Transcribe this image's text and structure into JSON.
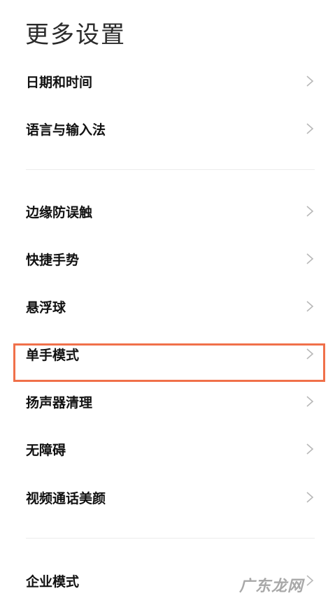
{
  "header": {
    "title": "更多设置"
  },
  "groups": [
    {
      "items": [
        {
          "label": "日期和时间"
        },
        {
          "label": "语言与输入法"
        }
      ]
    },
    {
      "items": [
        {
          "label": "边缘防误触"
        },
        {
          "label": "快捷手势"
        },
        {
          "label": "悬浮球"
        },
        {
          "label": "单手模式",
          "highlighted": true
        },
        {
          "label": "扬声器清理"
        },
        {
          "label": "无障碍"
        },
        {
          "label": "视频通话美颜"
        }
      ]
    },
    {
      "items": [
        {
          "label": "企业模式"
        }
      ]
    }
  ],
  "annotation": {
    "highlight_color": "#f0704a"
  },
  "watermark": {
    "text": "广东龙网"
  },
  "icons": {
    "chevron": "chevron-right-icon"
  }
}
